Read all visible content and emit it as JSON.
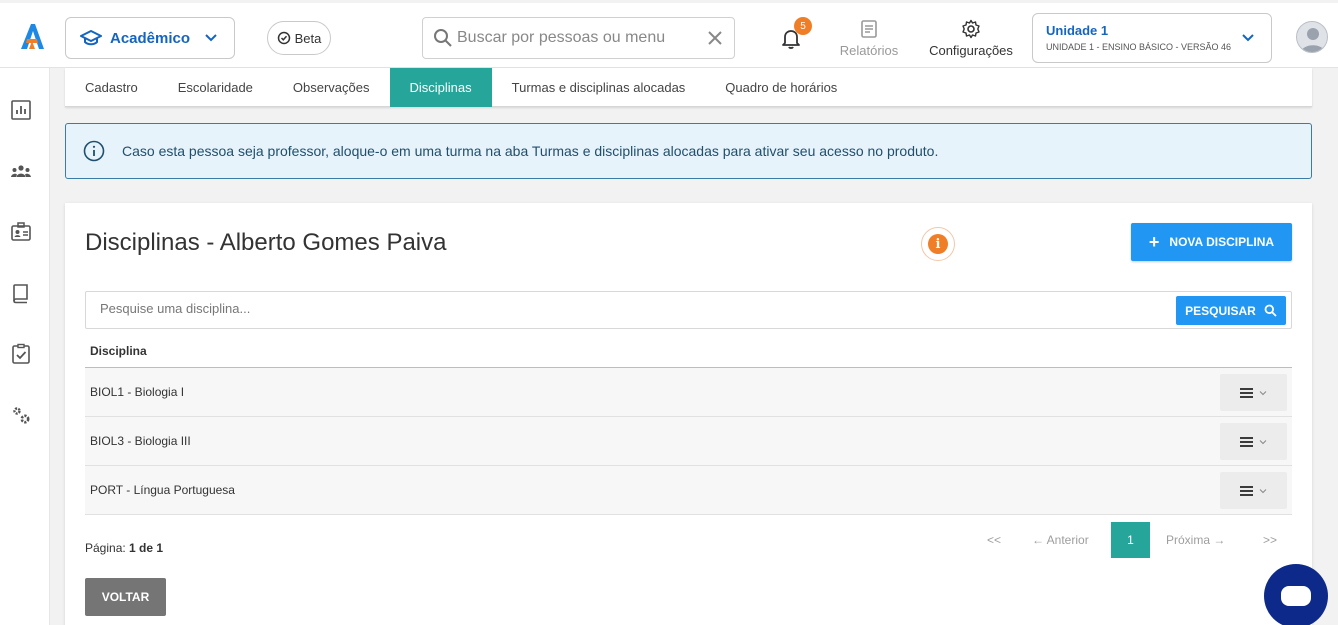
{
  "topbar": {
    "product_label": "Acadêmico",
    "beta_label": "Beta",
    "search_placeholder": "Buscar por pessoas ou menu",
    "notifications_count": "5",
    "reports_label": "Relatórios",
    "settings_label": "Configurações",
    "unit_title": "Unidade 1",
    "unit_subtitle": "UNIDADE 1 - ENSINO BÁSICO - VERSÃO 46"
  },
  "tabs": [
    {
      "label": "Cadastro"
    },
    {
      "label": "Escolaridade"
    },
    {
      "label": "Observações"
    },
    {
      "label": "Disciplinas",
      "active": true
    },
    {
      "label": "Turmas e disciplinas alocadas"
    },
    {
      "label": "Quadro de horários"
    }
  ],
  "alert": {
    "text": "Caso esta pessoa seja professor, aloque-o em uma turma na aba Turmas e disciplinas alocadas para ativar seu acesso no produto."
  },
  "main": {
    "title": "Disciplinas - Alberto Gomes Paiva",
    "new_button": "NOVA DISCIPLINA",
    "search_placeholder": "Pesquise uma disciplina...",
    "search_button": "PESQUISAR",
    "column_header": "Disciplina",
    "rows": [
      {
        "name": "BIOL1 - Biologia I"
      },
      {
        "name": "BIOL3 - Biologia III"
      },
      {
        "name": "PORT - Língua Portuguesa"
      }
    ],
    "page_label": "Página:",
    "page_value": "1 de 1",
    "pager": {
      "first": "<<",
      "prev": "← Anterior",
      "current": "1",
      "next": "Próxima →",
      "last": ">>"
    },
    "back_button": "VOLTAR"
  },
  "colors": {
    "accent_teal": "#26a69a",
    "primary_blue": "#2196f3",
    "brand_blue": "#1565c0",
    "badge_orange": "#f07e26",
    "chat_navy": "#0d2a8a"
  }
}
